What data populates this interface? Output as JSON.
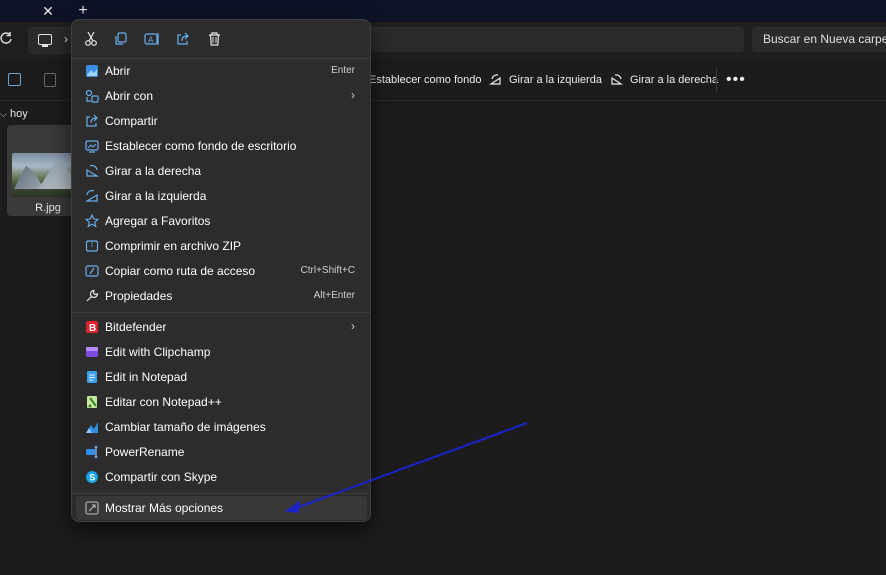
{
  "tabbar": {
    "close_glyph": "✕",
    "new_tab_glyph": "+"
  },
  "addressbar": {
    "search_placeholder": "Buscar en Nueva carpeta"
  },
  "commandbar": {
    "items": [
      {
        "label": "Establecer como fondo",
        "icon": "wallpaper-icon"
      },
      {
        "label": "Girar a la izquierda",
        "icon": "rotate-left-icon"
      },
      {
        "label": "Girar a la derecha",
        "icon": "rotate-right-icon"
      }
    ],
    "more_glyph": "•••"
  },
  "content": {
    "group_label": "hoy",
    "file": {
      "name": "R.jpg"
    }
  },
  "context_menu": {
    "quick_actions": [
      "cut-icon",
      "copy-icon",
      "rename-icon",
      "share-icon",
      "delete-icon"
    ],
    "items": [
      {
        "label": "Abrir",
        "shortcut": "Enter",
        "icon": "open-image-icon"
      },
      {
        "label": "Abrir con",
        "submenu": true,
        "icon": "open-with-icon"
      },
      {
        "label": "Compartir",
        "icon": "share-icon"
      },
      {
        "label": "Establecer como fondo de escritorio",
        "icon": "wallpaper-icon"
      },
      {
        "label": "Girar a la derecha",
        "icon": "rotate-right-icon"
      },
      {
        "label": "Girar a la izquierda",
        "icon": "rotate-left-icon"
      },
      {
        "label": "Agregar a Favoritos",
        "icon": "star-icon"
      },
      {
        "label": "Comprimir en archivo ZIP",
        "icon": "zip-icon"
      },
      {
        "label": "Copiar como ruta de acceso",
        "shortcut": "Ctrl+Shift+C",
        "icon": "copy-path-icon"
      },
      {
        "label": "Propiedades",
        "shortcut": "Alt+Enter",
        "icon": "wrench-icon"
      },
      {
        "label": "Bitdefender",
        "submenu": true,
        "icon": "bitdefender-icon"
      },
      {
        "label": "Edit with Clipchamp",
        "icon": "clipchamp-icon"
      },
      {
        "label": "Edit in Notepad",
        "icon": "notepad-icon"
      },
      {
        "label": "Editar con Notepad++",
        "icon": "notepad-plus-plus-icon"
      },
      {
        "label": "Cambiar tamaño de imágenes",
        "icon": "image-resizer-icon"
      },
      {
        "label": "PowerRename",
        "icon": "power-rename-icon"
      },
      {
        "label": "Compartir con Skype",
        "icon": "skype-icon"
      },
      {
        "label": "Mostrar Más opciones",
        "icon": "more-options-icon"
      }
    ],
    "submenu_glyph": "›"
  },
  "colors": {
    "background": "#1c1c1c",
    "menu_background": "#2c2c2c",
    "accent_blue": "#4da3ff",
    "annotation_arrow": "#1a22c8"
  }
}
